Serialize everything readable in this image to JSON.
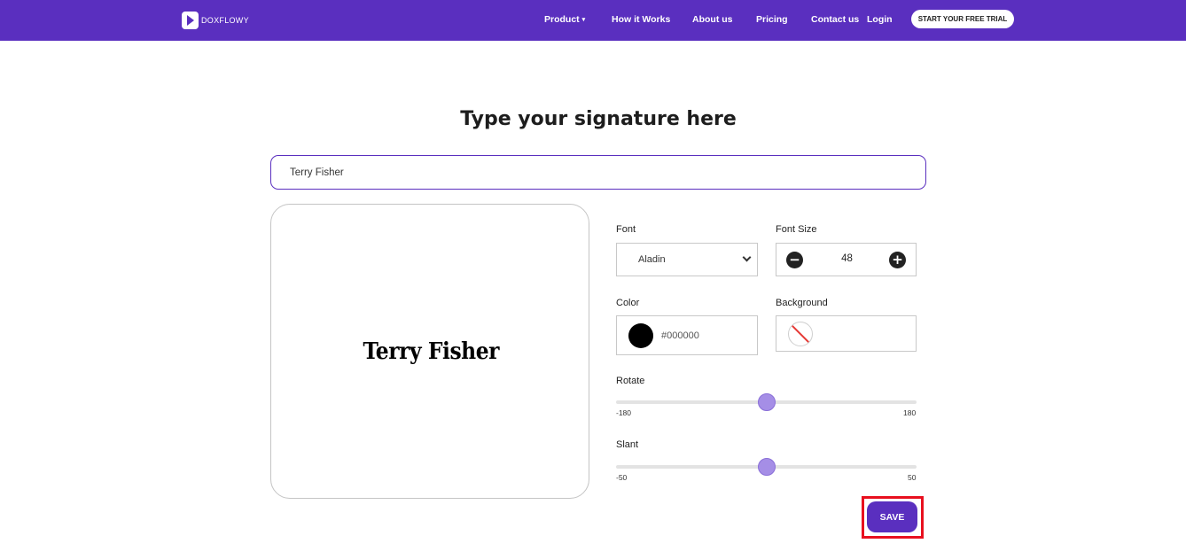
{
  "header": {
    "logo_text": "DOXFLOWY",
    "nav": [
      {
        "label": "Product"
      },
      {
        "label": "How it Works"
      },
      {
        "label": "About us"
      },
      {
        "label": "Pricing"
      },
      {
        "label": "Contact us"
      },
      {
        "label": "Login"
      }
    ],
    "trial_button": "START YOUR FREE TRIAL",
    "caret": "▾"
  },
  "main": {
    "title": "Type your signature here",
    "signature_input": "Terry Fisher",
    "preview_text": "Terry Fisher"
  },
  "controls": {
    "font_label": "Font",
    "font_value": "Aladin",
    "font_size_label": "Font Size",
    "font_size_value": "48",
    "minus": "−",
    "plus": "+",
    "color_label": "Color",
    "color_value": "#000000",
    "background_label": "Background",
    "rotate_label": "Rotate",
    "rotate_min": "-180",
    "rotate_max": "180",
    "rotate_value": 0,
    "slant_label": "Slant",
    "slant_min": "-50",
    "slant_max": "50",
    "slant_value": 0,
    "save_button": "SAVE"
  },
  "colors": {
    "brand": "#5a2fbf",
    "highlight": "#e8101f",
    "slider_thumb": "#a58ee6"
  }
}
